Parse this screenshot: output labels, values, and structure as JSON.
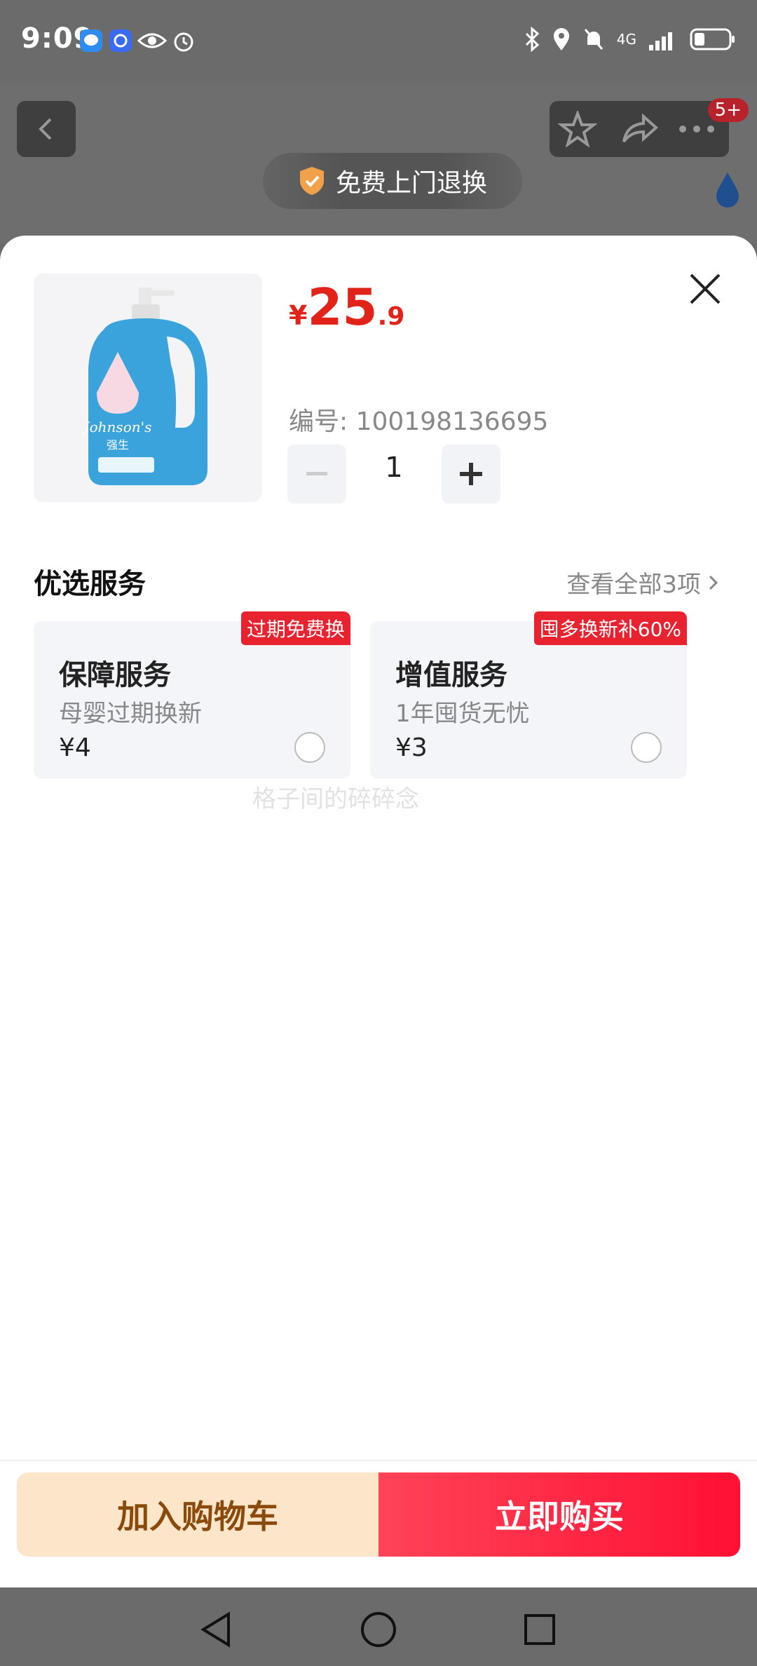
{
  "status_bar": {
    "time": "9:09",
    "network": "4G"
  },
  "background": {
    "badge_count": "5+",
    "free_return_label": "免费上门退换"
  },
  "product": {
    "price_symbol": "¥",
    "price_integer": "25",
    "price_decimal": ".9",
    "sku_label": "编号: 100198136695",
    "quantity": "1",
    "image_brand": "Johnson's 强生"
  },
  "services": {
    "title": "优选服务",
    "view_all": "查看全部3项",
    "cards": [
      {
        "tag": "过期免费换",
        "title": "保障服务",
        "subtitle": "母婴过期换新",
        "price": "¥4"
      },
      {
        "tag": "囤多换新补60%",
        "title": "增值服务",
        "subtitle": "1年囤货无忧",
        "price": "¥3"
      }
    ]
  },
  "watermark": "格子间的碎碎念",
  "actions": {
    "add_to_cart": "加入购物车",
    "buy_now": "立即购买"
  },
  "colors": {
    "price_red": "#e2231a",
    "tag_red": "#e8222e",
    "cart_bg": "#fde5ca",
    "buy_red": "#ff1133"
  }
}
